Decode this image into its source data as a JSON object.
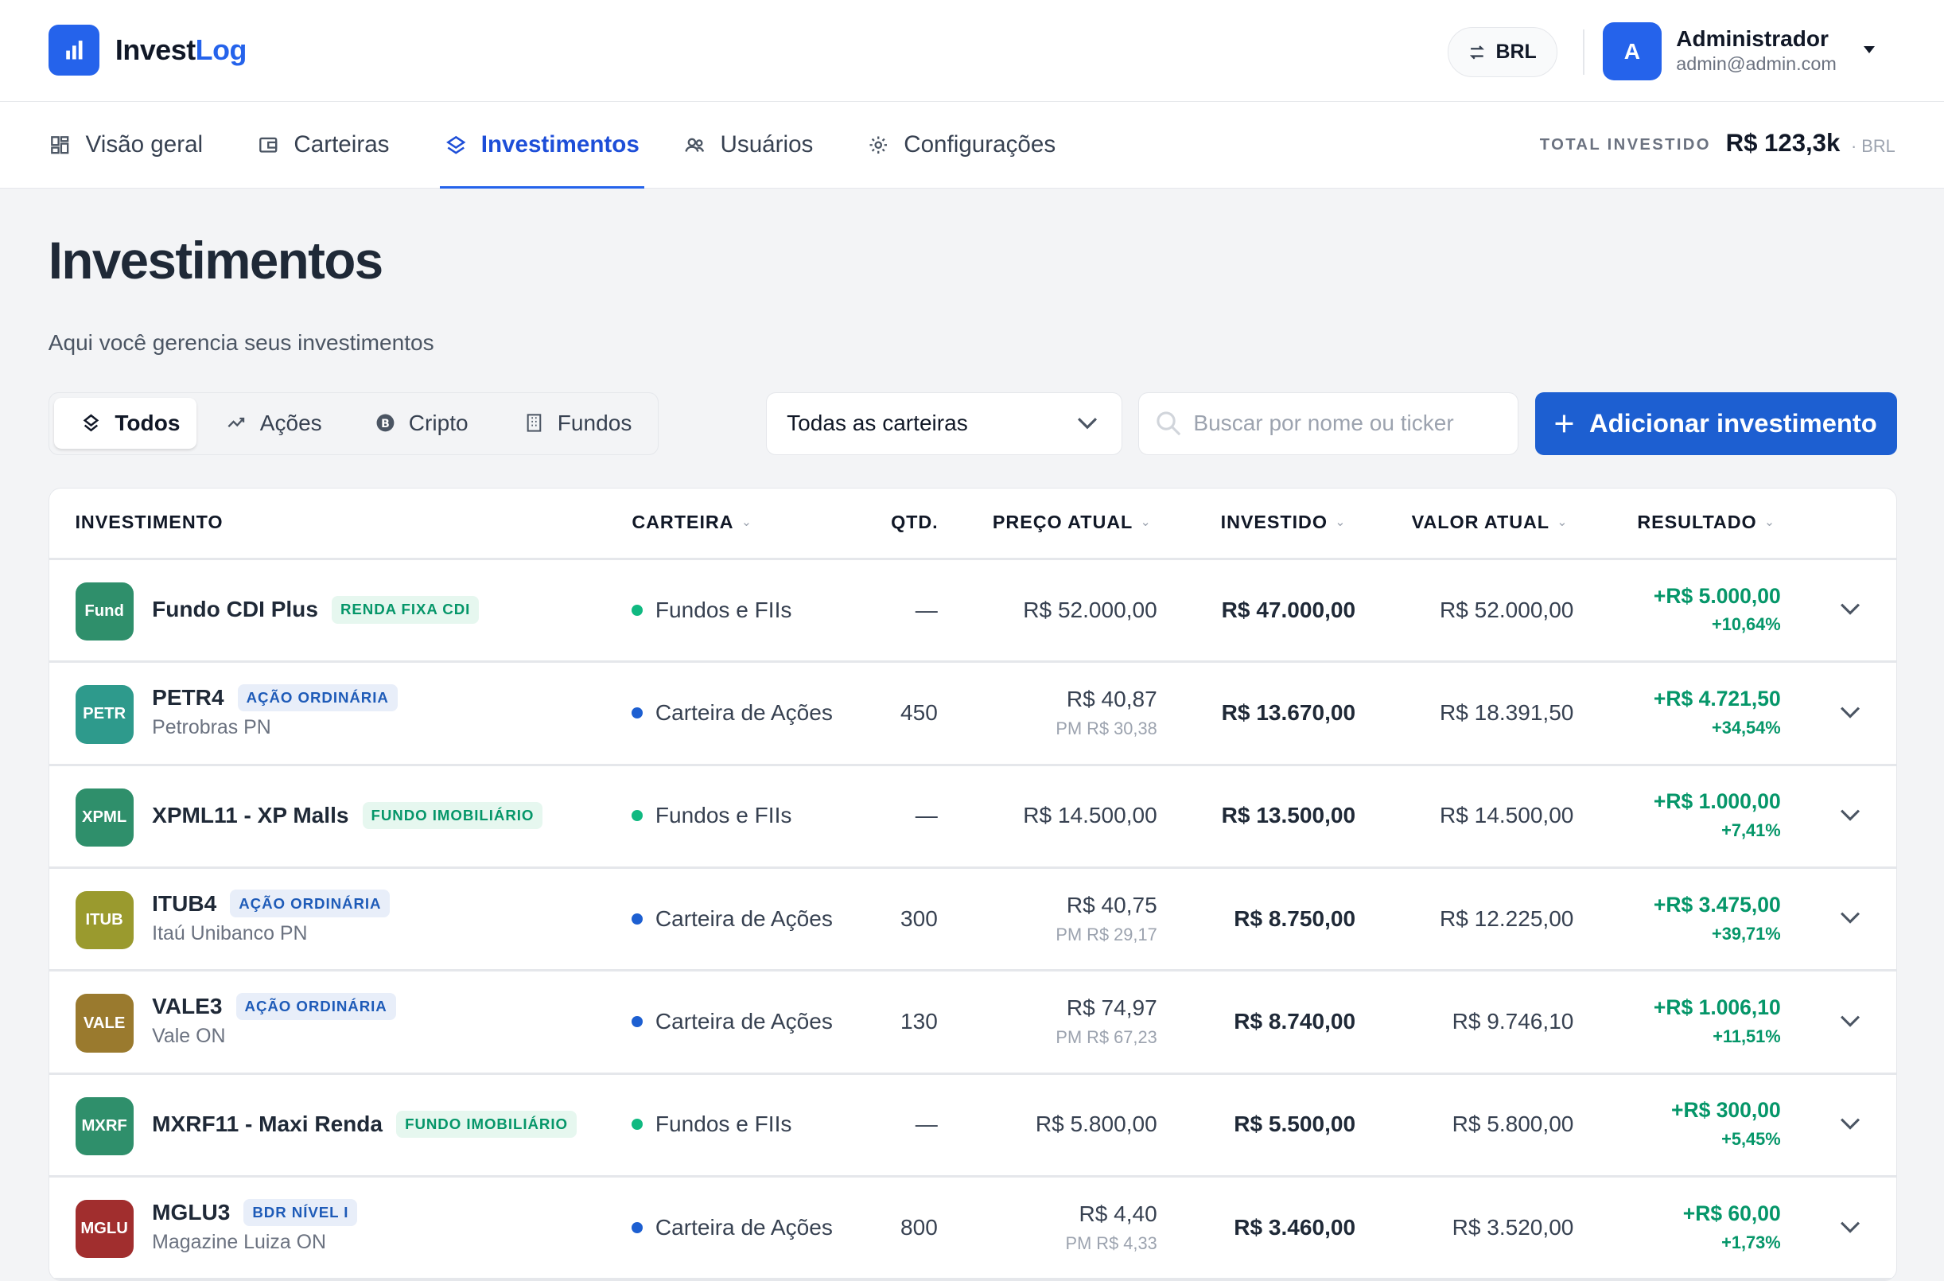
{
  "app": {
    "brand_part1": "Invest",
    "brand_part2": "Log",
    "currency": "BRL",
    "user": {
      "initial": "A",
      "name": "Administrador",
      "email": "admin@admin.com"
    }
  },
  "nav": {
    "items": [
      {
        "label": "Visão geral",
        "icon": "grid-icon"
      },
      {
        "label": "Carteiras",
        "icon": "wallet-icon"
      },
      {
        "label": "Investimentos",
        "icon": "layers-icon",
        "active": true
      },
      {
        "label": "Usuários",
        "icon": "users-icon"
      },
      {
        "label": "Configurações",
        "icon": "gear-icon"
      }
    ],
    "total_label": "TOTAL INVESTIDO",
    "total_value": "R$ 123,3k",
    "total_currency": "· BRL"
  },
  "page": {
    "title": "Investimentos",
    "subtitle": "Aqui você gerencia seus investimentos"
  },
  "filters": {
    "types": [
      "Todos",
      "Ações",
      "Cripto",
      "Fundos"
    ],
    "active_type": "Todos",
    "wallet_select": "Todas as carteiras",
    "search_placeholder": "Buscar por nome ou ticker",
    "add_button": "Adicionar investimento"
  },
  "table": {
    "headers": {
      "investment": "INVESTIMENTO",
      "wallet": "CARTEIRA",
      "qty": "QTD.",
      "price": "PREÇO ATUAL",
      "invested": "INVESTIDO",
      "current": "VALOR ATUAL",
      "result": "RESULTADO"
    },
    "rows": [
      {
        "tile": "Fund",
        "tile_color": "#2f8f6b",
        "name": "Fundo CDI Plus",
        "badge": "RENDA FIXA CDI",
        "badge_style": "green",
        "sub": "",
        "wallet": "Fundos e FIIs",
        "wallet_color": "#10b981",
        "qty": "—",
        "price": "R$ 52.000,00",
        "pm": "",
        "invested": "R$ 47.000,00",
        "current": "R$ 52.000,00",
        "result": "+R$ 5.000,00",
        "result_pct": "+10,64%"
      },
      {
        "tile": "PETR",
        "tile_color": "#2e9a8c",
        "name": "PETR4",
        "badge": "AÇÃO ORDINÁRIA",
        "badge_style": "blue",
        "sub": "Petrobras PN",
        "wallet": "Carteira de Ações",
        "wallet_color": "#1d5fd1",
        "qty": "450",
        "price": "R$ 40,87",
        "pm": "PM R$ 30,38",
        "invested": "R$ 13.670,00",
        "current": "R$ 18.391,50",
        "result": "+R$ 4.721,50",
        "result_pct": "+34,54%"
      },
      {
        "tile": "XPML",
        "tile_color": "#2f8f6b",
        "name": "XPML11 - XP Malls",
        "badge": "FUNDO IMOBILIÁRIO",
        "badge_style": "green",
        "sub": "",
        "wallet": "Fundos e FIIs",
        "wallet_color": "#10b981",
        "qty": "—",
        "price": "R$ 14.500,00",
        "pm": "",
        "invested": "R$ 13.500,00",
        "current": "R$ 14.500,00",
        "result": "+R$ 1.000,00",
        "result_pct": "+7,41%"
      },
      {
        "tile": "ITUB",
        "tile_color": "#9a9a2e",
        "name": "ITUB4",
        "badge": "AÇÃO ORDINÁRIA",
        "badge_style": "blue",
        "sub": "Itaú Unibanco PN",
        "wallet": "Carteira de Ações",
        "wallet_color": "#1d5fd1",
        "qty": "300",
        "price": "R$ 40,75",
        "pm": "PM R$ 29,17",
        "invested": "R$ 8.750,00",
        "current": "R$ 12.225,00",
        "result": "+R$ 3.475,00",
        "result_pct": "+39,71%"
      },
      {
        "tile": "VALE",
        "tile_color": "#9a7a2e",
        "name": "VALE3",
        "badge": "AÇÃO ORDINÁRIA",
        "badge_style": "blue",
        "sub": "Vale ON",
        "wallet": "Carteira de Ações",
        "wallet_color": "#1d5fd1",
        "qty": "130",
        "price": "R$ 74,97",
        "pm": "PM R$ 67,23",
        "invested": "R$ 8.740,00",
        "current": "R$ 9.746,10",
        "result": "+R$ 1.006,10",
        "result_pct": "+11,51%"
      },
      {
        "tile": "MXRF",
        "tile_color": "#2f8f6b",
        "name": "MXRF11 - Maxi Renda",
        "badge": "FUNDO IMOBILIÁRIO",
        "badge_style": "green",
        "sub": "",
        "wallet": "Fundos e FIIs",
        "wallet_color": "#10b981",
        "qty": "—",
        "price": "R$ 5.800,00",
        "pm": "",
        "invested": "R$ 5.500,00",
        "current": "R$ 5.800,00",
        "result": "+R$ 300,00",
        "result_pct": "+5,45%"
      },
      {
        "tile": "MGLU",
        "tile_color": "#a12e2e",
        "name": "MGLU3",
        "badge": "BDR NÍVEL I",
        "badge_style": "blue",
        "sub": "Magazine Luiza ON",
        "wallet": "Carteira de Ações",
        "wallet_color": "#1d5fd1",
        "qty": "800",
        "price": "R$ 4,40",
        "pm": "PM R$ 4,33",
        "invested": "R$ 3.460,00",
        "current": "R$ 3.520,00",
        "result": "+R$ 60,00",
        "result_pct": "+1,73%"
      }
    ]
  }
}
